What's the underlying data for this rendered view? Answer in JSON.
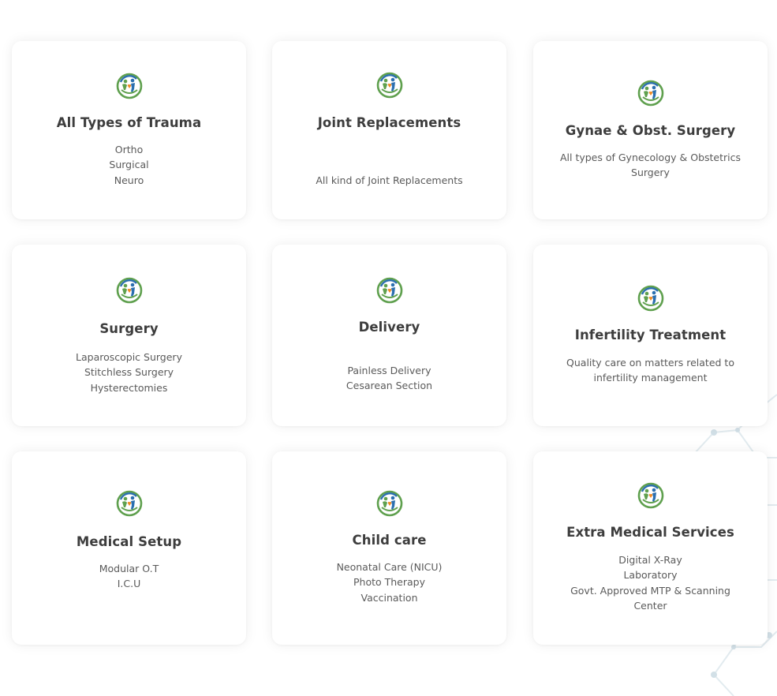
{
  "services": [
    {
      "title": "All Types of Trauma",
      "icon": "hospital-logo-icon",
      "lines": [
        "Ortho",
        "Surgical",
        "Neuro"
      ]
    },
    {
      "title": "Joint Replacements",
      "icon": "hospital-logo-icon",
      "lines": [
        "All kind of Joint Replacements"
      ]
    },
    {
      "title": "Gynae & Obst. Surgery",
      "icon": "hospital-logo-icon",
      "lines": [
        "All types of  Gynecology & Obstetrics Surgery"
      ]
    },
    {
      "title": "Surgery",
      "icon": "hospital-logo-icon",
      "lines": [
        "Laparoscopic Surgery",
        "Stitchless Surgery",
        "Hysterectomies"
      ]
    },
    {
      "title": "Delivery",
      "icon": "hospital-logo-icon",
      "lines": [
        "Painless Delivery",
        "Cesarean Section"
      ]
    },
    {
      "title": "Infertility Treatment",
      "icon": "hospital-logo-icon",
      "lines": [
        "Quality care on matters related to infertility management"
      ]
    },
    {
      "title": "Medical Setup",
      "icon": "hospital-logo-icon",
      "lines": [
        "Modular O.T",
        "I.C.U"
      ]
    },
    {
      "title": "Child care",
      "icon": "hospital-logo-icon",
      "lines": [
        "Neonatal Care (NICU)",
        "Photo Therapy",
        "Vaccination"
      ]
    },
    {
      "title": "Extra Medical Services",
      "icon": "hospital-logo-icon",
      "lines": [
        "Digital X-Ray",
        "Laboratory",
        "Govt. Approved MTP & Scanning Center"
      ]
    }
  ],
  "colors": {
    "logo_green": "#5fa04e",
    "logo_blue": "#2b6fb0",
    "logo_orange": "#f08a24",
    "title": "#3d3d3d",
    "text": "#5a5a5a"
  }
}
